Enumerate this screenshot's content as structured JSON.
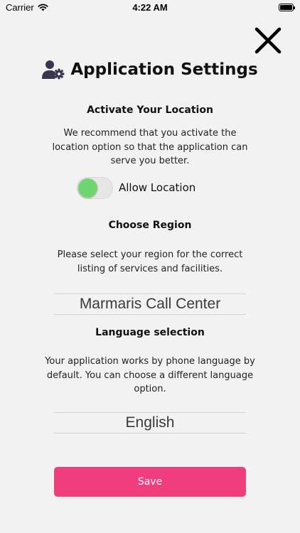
{
  "status_bar": {
    "carrier": "Carrier",
    "time": "4:22 AM",
    "battery_level": 1.0
  },
  "header": {
    "title": "Application Settings",
    "title_icon": "user-gear-icon",
    "close_icon": "close-icon"
  },
  "location": {
    "heading": "Activate Your Location",
    "description": "We recommend that you activate the location option so that the application can serve you better.",
    "toggle_label": "Allow Location",
    "toggle_on": true
  },
  "region": {
    "heading": "Choose Region",
    "description": "Please select your region for the correct listing of services and facilities.",
    "selected": "Marmaris Call Center"
  },
  "language": {
    "heading": "Language selection",
    "description": "Your application works by phone language by default. You can choose a different language option.",
    "selected": "English"
  },
  "actions": {
    "save_label": "Save"
  },
  "colors": {
    "accent": "#f03e7d",
    "toggle_knob": "#6fd66f",
    "icon": "#3a3550",
    "background": "#f2f2f2"
  }
}
